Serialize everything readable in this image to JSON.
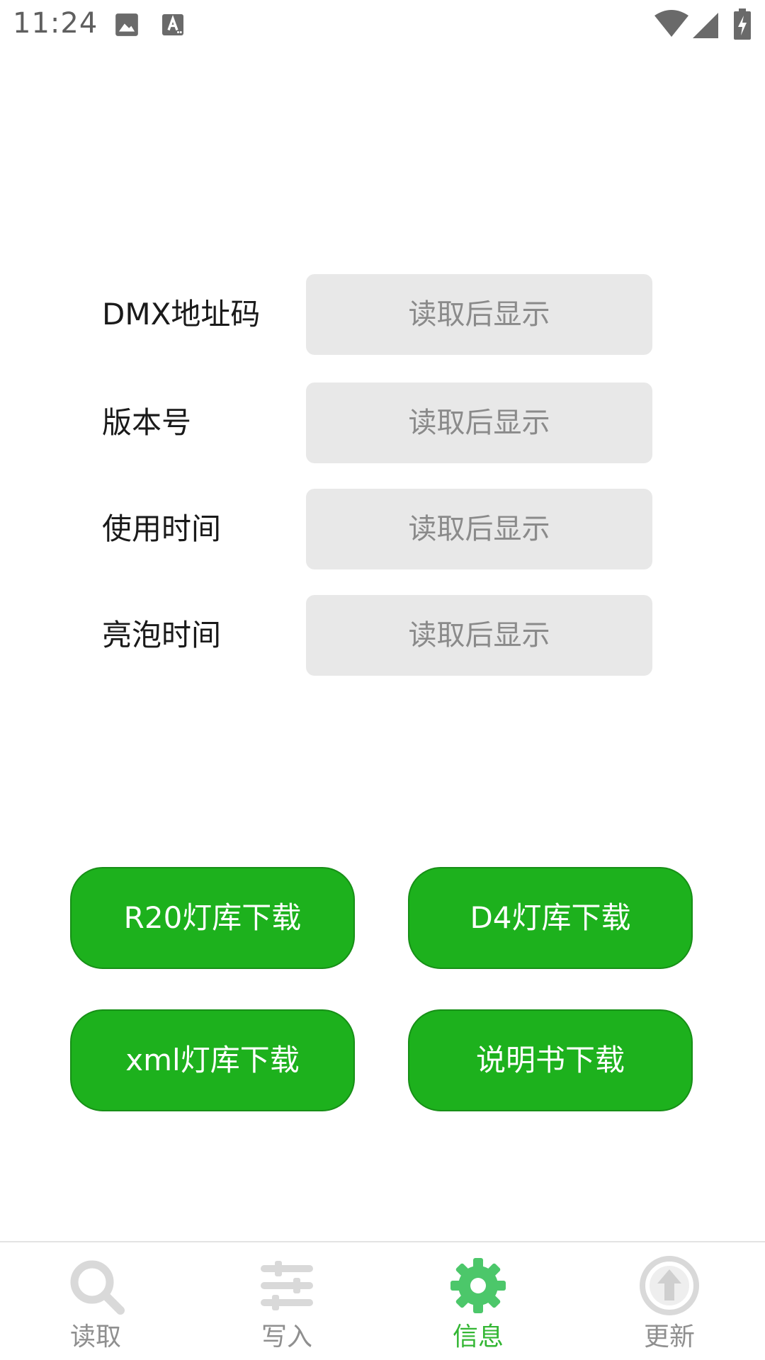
{
  "status_bar": {
    "time": "11:24",
    "icons": [
      "image-icon",
      "text-a-icon",
      "wifi-icon",
      "cell-signal-icon",
      "battery-charging-icon"
    ]
  },
  "info": {
    "rows": [
      {
        "label": "DMX地址码",
        "value": "读取后显示"
      },
      {
        "label": "版本号",
        "value": "读取后显示"
      },
      {
        "label": "使用时间",
        "value": "读取后显示"
      },
      {
        "label": "亮泡时间",
        "value": "读取后显示"
      }
    ]
  },
  "downloads": {
    "r20": "R20灯库下载",
    "d4": "D4灯库下载",
    "xml": "xml灯库下载",
    "manual": "说明书下载"
  },
  "nav": {
    "items": [
      {
        "label": "读取",
        "icon": "search-icon"
      },
      {
        "label": "写入",
        "icon": "sliders-icon"
      },
      {
        "label": "信息",
        "icon": "gear-icon",
        "active": true
      },
      {
        "label": "更新",
        "icon": "upload-icon"
      }
    ]
  },
  "colors": {
    "accent_green": "#1db11d",
    "active_nav": "#33b633",
    "inactive_nav": "#8f8f8f",
    "field_bg": "#e8e8e8"
  }
}
